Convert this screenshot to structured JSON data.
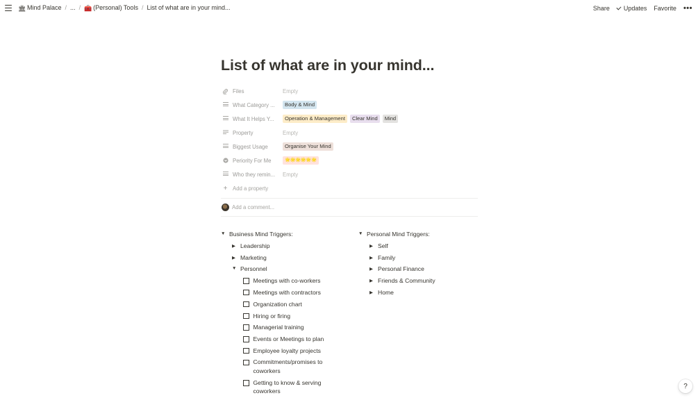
{
  "breadcrumb": {
    "items": [
      {
        "icon": "🏛",
        "label": "Mind Palace"
      },
      {
        "icon": "",
        "label": "..."
      },
      {
        "icon": "🧰",
        "label": "(Personal) Tools"
      },
      {
        "icon": "",
        "label": "List of what are in your mind..."
      }
    ]
  },
  "topbar": {
    "share": "Share",
    "updates": "Updates",
    "favorite": "Favorite",
    "more": "•••"
  },
  "page": {
    "title": "List of what are in your mind...",
    "properties": [
      {
        "name": "Files",
        "icon": "paperclip-icon",
        "value": "Empty",
        "tags": []
      },
      {
        "name": "What Category ...",
        "icon": "list-icon",
        "tags": [
          {
            "label": "Body & Mind",
            "color": "#d3e5ef"
          }
        ]
      },
      {
        "name": "What It Helps Y...",
        "icon": "list-icon",
        "tags": [
          {
            "label": "Operation & Management",
            "color": "#fdecc8"
          },
          {
            "label": "Clear Mind",
            "color": "#e8deee"
          },
          {
            "label": "Mind",
            "color": "#e3e2e0"
          }
        ]
      },
      {
        "name": "Property",
        "icon": "text-icon",
        "value": "Empty",
        "tags": []
      },
      {
        "name": "Biggest Usage",
        "icon": "list-icon",
        "tags": [
          {
            "label": "Organise Your Mind",
            "color": "#eee0da"
          }
        ]
      },
      {
        "name": "Periority For Me",
        "icon": "select-icon",
        "tags": [
          {
            "label": "🌟🌟🌟🌟🌟🌟",
            "color": "#ffe2dd"
          }
        ]
      },
      {
        "name": "Who they remin...",
        "icon": "list-icon",
        "value": "Empty",
        "tags": []
      }
    ],
    "add_property": "Add a property",
    "comment_placeholder": "Add a comment..."
  },
  "toggles": {
    "business": {
      "label": "Business Mind Triggers:",
      "children": [
        {
          "label": "Leadership"
        },
        {
          "label": "Marketing"
        },
        {
          "label": "Personnel",
          "open": true,
          "items": [
            "Meetings with co-workers",
            "Meetings with contractors",
            "Organization chart",
            "Hiring or firing",
            "Managerial training",
            "Events or Meetings to plan",
            "Employee loyalty projects",
            "Commitments/promises to coworkers",
            "Getting to know & serving coworkers"
          ]
        }
      ]
    },
    "personal": {
      "label": "Personal Mind Triggers:",
      "children": [
        "Self",
        "Family",
        "Personal Finance",
        "Friends & Community",
        "Home"
      ]
    }
  },
  "help": "?"
}
